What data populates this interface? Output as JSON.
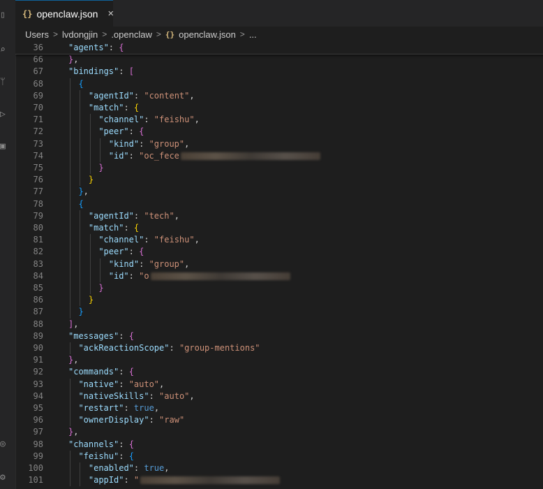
{
  "tab": {
    "icon": "{}",
    "title": "openclaw.json",
    "close": "×"
  },
  "breadcrumb": [
    "Users",
    "lvdongjin",
    ".openclaw",
    "openclaw.json",
    "..."
  ],
  "lines": [
    {
      "n": "36",
      "sticky": true,
      "indent": 0,
      "tokens": [
        [
          "k",
          "\"agents\""
        ],
        [
          "p",
          ": "
        ],
        [
          "br2",
          "{"
        ]
      ]
    },
    {
      "n": "66",
      "indent": 0,
      "tokens": [
        [
          "br2",
          "}"
        ],
        [
          "p",
          ","
        ]
      ]
    },
    {
      "n": "67",
      "indent": 0,
      "tokens": [
        [
          "k",
          "\"bindings\""
        ],
        [
          "p",
          ": "
        ],
        [
          "br2",
          "["
        ]
      ]
    },
    {
      "n": "68",
      "indent": 1,
      "tokens": [
        [
          "br3",
          "{"
        ]
      ]
    },
    {
      "n": "69",
      "indent": 2,
      "tokens": [
        [
          "k",
          "\"agentId\""
        ],
        [
          "p",
          ": "
        ],
        [
          "s",
          "\"content\""
        ],
        [
          "p",
          ","
        ]
      ]
    },
    {
      "n": "70",
      "indent": 2,
      "tokens": [
        [
          "k",
          "\"match\""
        ],
        [
          "p",
          ": "
        ],
        [
          "br1",
          "{"
        ]
      ]
    },
    {
      "n": "71",
      "indent": 3,
      "tokens": [
        [
          "k",
          "\"channel\""
        ],
        [
          "p",
          ": "
        ],
        [
          "s",
          "\"feishu\""
        ],
        [
          "p",
          ","
        ]
      ]
    },
    {
      "n": "72",
      "indent": 3,
      "tokens": [
        [
          "k",
          "\"peer\""
        ],
        [
          "p",
          ": "
        ],
        [
          "br2",
          "{"
        ]
      ]
    },
    {
      "n": "73",
      "indent": 4,
      "tokens": [
        [
          "k",
          "\"kind\""
        ],
        [
          "p",
          ": "
        ],
        [
          "s",
          "\"group\""
        ],
        [
          "p",
          ","
        ]
      ]
    },
    {
      "n": "74",
      "indent": 4,
      "tokens": [
        [
          "k",
          "\"id\""
        ],
        [
          "p",
          ": "
        ],
        [
          "s",
          "\"oc_fece"
        ]
      ],
      "redact": true
    },
    {
      "n": "75",
      "indent": 3,
      "tokens": [
        [
          "br2",
          "}"
        ]
      ]
    },
    {
      "n": "76",
      "indent": 2,
      "tokens": [
        [
          "br1",
          "}"
        ]
      ]
    },
    {
      "n": "77",
      "indent": 1,
      "tokens": [
        [
          "br3",
          "}"
        ],
        [
          "p",
          ","
        ]
      ]
    },
    {
      "n": "78",
      "indent": 1,
      "tokens": [
        [
          "br3",
          "{"
        ]
      ]
    },
    {
      "n": "79",
      "indent": 2,
      "tokens": [
        [
          "k",
          "\"agentId\""
        ],
        [
          "p",
          ": "
        ],
        [
          "s",
          "\"tech\""
        ],
        [
          "p",
          ","
        ]
      ]
    },
    {
      "n": "80",
      "indent": 2,
      "tokens": [
        [
          "k",
          "\"match\""
        ],
        [
          "p",
          ": "
        ],
        [
          "br1",
          "{"
        ]
      ]
    },
    {
      "n": "81",
      "indent": 3,
      "tokens": [
        [
          "k",
          "\"channel\""
        ],
        [
          "p",
          ": "
        ],
        [
          "s",
          "\"feishu\""
        ],
        [
          "p",
          ","
        ]
      ]
    },
    {
      "n": "82",
      "indent": 3,
      "tokens": [
        [
          "k",
          "\"peer\""
        ],
        [
          "p",
          ": "
        ],
        [
          "br2",
          "{"
        ]
      ]
    },
    {
      "n": "83",
      "indent": 4,
      "tokens": [
        [
          "k",
          "\"kind\""
        ],
        [
          "p",
          ": "
        ],
        [
          "s",
          "\"group\""
        ],
        [
          "p",
          ","
        ]
      ]
    },
    {
      "n": "84",
      "indent": 4,
      "tokens": [
        [
          "k",
          "\"id\""
        ],
        [
          "p",
          ": "
        ],
        [
          "s",
          "\"o"
        ]
      ],
      "redact": true
    },
    {
      "n": "85",
      "indent": 3,
      "tokens": [
        [
          "br2",
          "}"
        ]
      ]
    },
    {
      "n": "86",
      "indent": 2,
      "tokens": [
        [
          "br1",
          "}"
        ]
      ]
    },
    {
      "n": "87",
      "indent": 1,
      "tokens": [
        [
          "br3",
          "}"
        ]
      ]
    },
    {
      "n": "88",
      "indent": 0,
      "tokens": [
        [
          "br2",
          "]"
        ],
        [
          "p",
          ","
        ]
      ]
    },
    {
      "n": "89",
      "indent": 0,
      "tokens": [
        [
          "k",
          "\"messages\""
        ],
        [
          "p",
          ": "
        ],
        [
          "br2",
          "{"
        ]
      ]
    },
    {
      "n": "90",
      "indent": 1,
      "tokens": [
        [
          "k",
          "\"ackReactionScope\""
        ],
        [
          "p",
          ": "
        ],
        [
          "s",
          "\"group-mentions\""
        ]
      ]
    },
    {
      "n": "91",
      "indent": 0,
      "tokens": [
        [
          "br2",
          "}"
        ],
        [
          "p",
          ","
        ]
      ]
    },
    {
      "n": "92",
      "indent": 0,
      "tokens": [
        [
          "k",
          "\"commands\""
        ],
        [
          "p",
          ": "
        ],
        [
          "br2",
          "{"
        ]
      ]
    },
    {
      "n": "93",
      "indent": 1,
      "tokens": [
        [
          "k",
          "\"native\""
        ],
        [
          "p",
          ": "
        ],
        [
          "s",
          "\"auto\""
        ],
        [
          "p",
          ","
        ]
      ]
    },
    {
      "n": "94",
      "indent": 1,
      "tokens": [
        [
          "k",
          "\"nativeSkills\""
        ],
        [
          "p",
          ": "
        ],
        [
          "s",
          "\"auto\""
        ],
        [
          "p",
          ","
        ]
      ]
    },
    {
      "n": "95",
      "indent": 1,
      "tokens": [
        [
          "k",
          "\"restart\""
        ],
        [
          "p",
          ": "
        ],
        [
          "b",
          "true"
        ],
        [
          "p",
          ","
        ]
      ]
    },
    {
      "n": "96",
      "indent": 1,
      "tokens": [
        [
          "k",
          "\"ownerDisplay\""
        ],
        [
          "p",
          ": "
        ],
        [
          "s",
          "\"raw\""
        ]
      ]
    },
    {
      "n": "97",
      "indent": 0,
      "tokens": [
        [
          "br2",
          "}"
        ],
        [
          "p",
          ","
        ]
      ]
    },
    {
      "n": "98",
      "indent": 0,
      "tokens": [
        [
          "k",
          "\"channels\""
        ],
        [
          "p",
          ": "
        ],
        [
          "br2",
          "{"
        ]
      ]
    },
    {
      "n": "99",
      "indent": 1,
      "tokens": [
        [
          "k",
          "\"feishu\""
        ],
        [
          "p",
          ": "
        ],
        [
          "br3",
          "{"
        ]
      ]
    },
    {
      "n": "100",
      "indent": 2,
      "tokens": [
        [
          "k",
          "\"enabled\""
        ],
        [
          "p",
          ": "
        ],
        [
          "b",
          "true"
        ],
        [
          "p",
          ","
        ]
      ]
    },
    {
      "n": "101",
      "indent": 2,
      "tokens": [
        [
          "k",
          "\"appId\""
        ],
        [
          "p",
          ": "
        ],
        [
          "s",
          "\""
        ]
      ],
      "redact": true
    }
  ]
}
